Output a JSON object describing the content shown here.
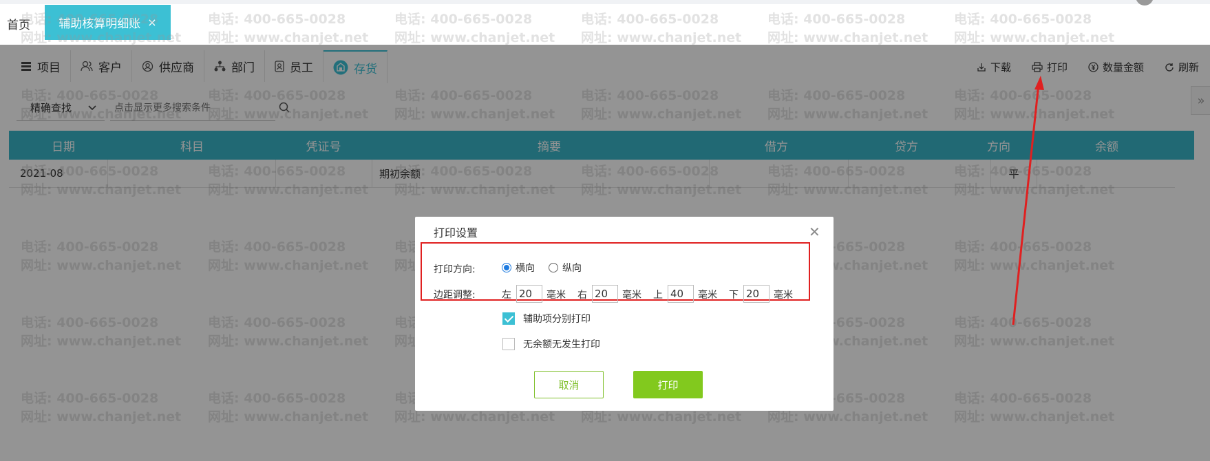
{
  "top": {
    "home_label": "首页",
    "active_tab_label": "辅助核算明细账",
    "close_glyph": "×"
  },
  "tabs": [
    {
      "label": "项目",
      "icon": "list-icon"
    },
    {
      "label": "客户",
      "icon": "user-icon"
    },
    {
      "label": "供应商",
      "icon": "supplier-icon"
    },
    {
      "label": "部门",
      "icon": "org-icon"
    },
    {
      "label": "员工",
      "icon": "badge-icon"
    },
    {
      "label": "存货",
      "icon": "box-icon",
      "active": true
    }
  ],
  "toolbar": {
    "download_label": "下载",
    "print_label": "打印",
    "qty_amount_label": "数量金额",
    "refresh_label": "刷新"
  },
  "search": {
    "mode_label": "精确查找",
    "placeholder": "点击显示更多搜索条件"
  },
  "table": {
    "columns": [
      "日期",
      "科目",
      "凭证号",
      "摘要",
      "借方",
      "贷方",
      "方向",
      "余额"
    ],
    "rows": [
      [
        "2021-08",
        "",
        "",
        "期初余额",
        "",
        "",
        "平",
        ""
      ]
    ]
  },
  "watermark": {
    "phone": "电话: 400-665-0028",
    "site": "网址: www.chanjet.net"
  },
  "dialog": {
    "title": "打印设置",
    "close_glyph": "✕",
    "orientation_label": "打印方向:",
    "landscape_label": "横向",
    "portrait_label": "纵向",
    "margin_label": "边距调整:",
    "margins": [
      {
        "side": "左",
        "value": "20",
        "unit": "毫米"
      },
      {
        "side": "右",
        "value": "20",
        "unit": "毫米"
      },
      {
        "side": "上",
        "value": "40",
        "unit": "毫米"
      },
      {
        "side": "下",
        "value": "20",
        "unit": "毫米"
      }
    ],
    "separate_print_label": "辅助项分别打印",
    "separate_print_checked": true,
    "no_balance_label": "无余额无发生打印",
    "no_balance_checked": false,
    "cancel_label": "取消",
    "print_label": "打印"
  },
  "colors": {
    "accent": "#3cc0d4",
    "header": "#3ab6c8",
    "green": "#82c91e",
    "annotation_red": "#e02020"
  }
}
